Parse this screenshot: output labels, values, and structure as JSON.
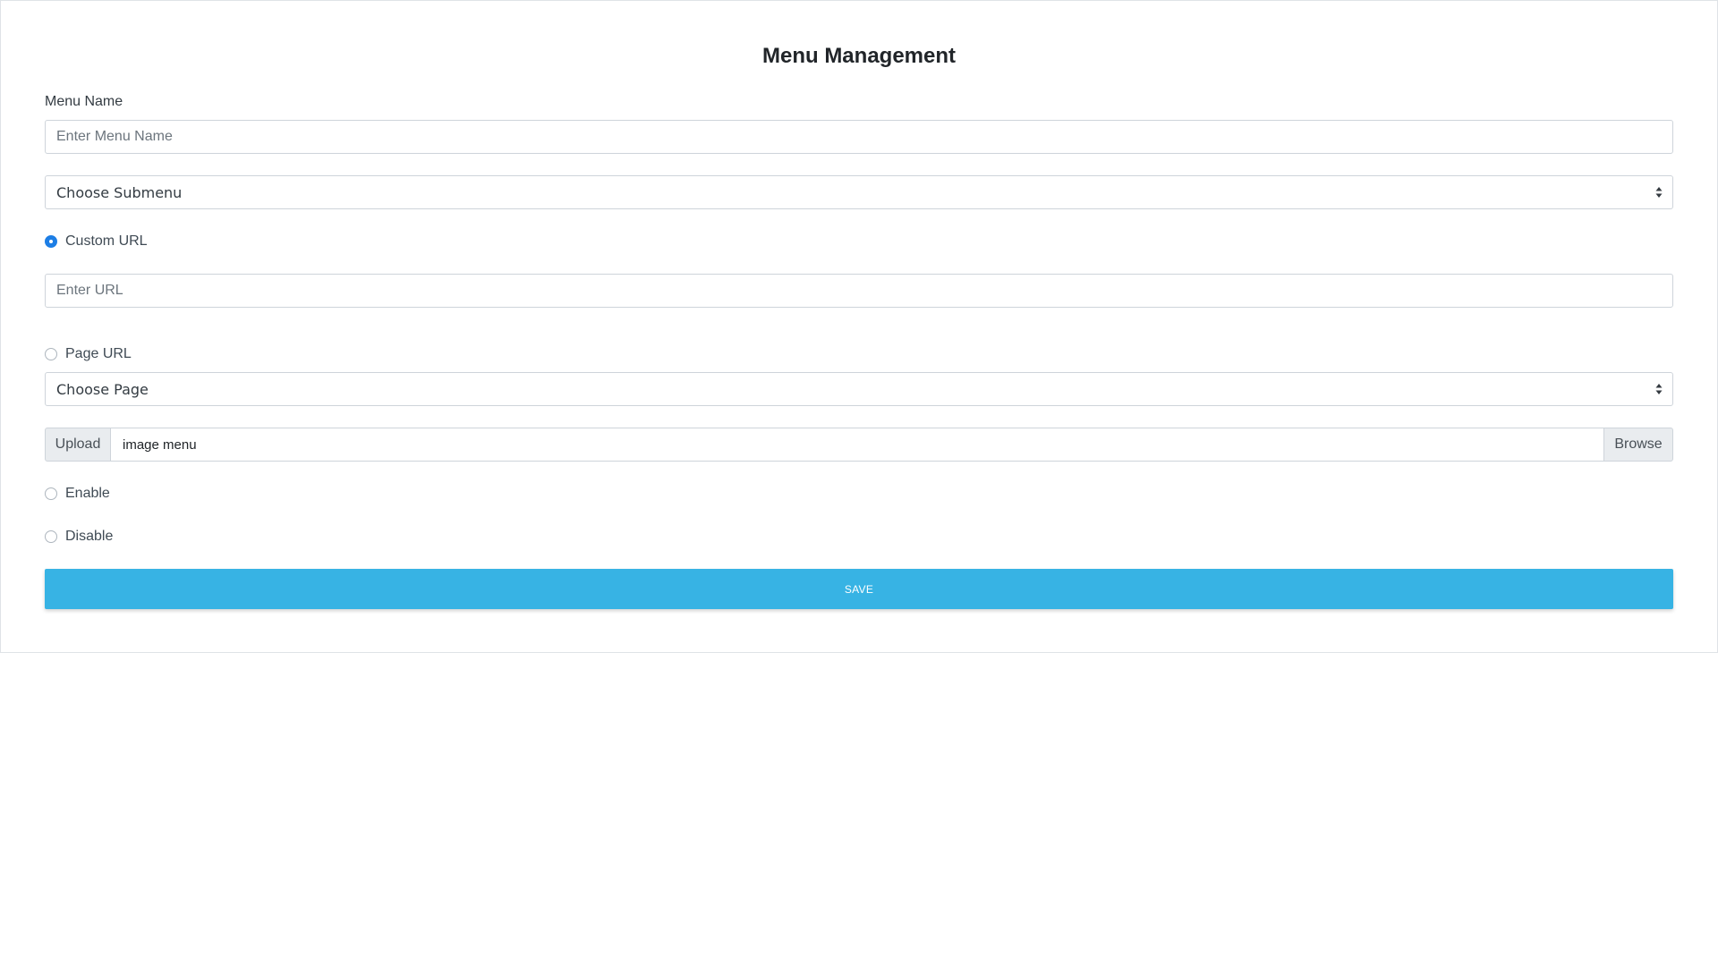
{
  "page": {
    "title": "Menu Management"
  },
  "form": {
    "menu_name_label": "Menu Name",
    "menu_name_placeholder": "Enter Menu Name",
    "submenu_select": {
      "selected": "Choose Submenu"
    },
    "custom_url_option": {
      "label": "Custom URL",
      "checked": true
    },
    "url_placeholder": "Enter URL",
    "page_url_option": {
      "label": "Page URL",
      "checked": false
    },
    "page_select": {
      "selected": "Choose Page"
    },
    "upload": {
      "prefix_label": "Upload",
      "file_name": "image menu",
      "browse_label": "Browse"
    },
    "enable_option": {
      "label": "Enable",
      "checked": false
    },
    "disable_option": {
      "label": "Disable",
      "checked": false
    },
    "save_label": "SAVE"
  },
  "colors": {
    "save_button": "#37b3e4",
    "radio_checked": "#1d7ee5",
    "border": "#ced4da"
  },
  "icons": {
    "select_arrow": "select-arrows-icon"
  }
}
